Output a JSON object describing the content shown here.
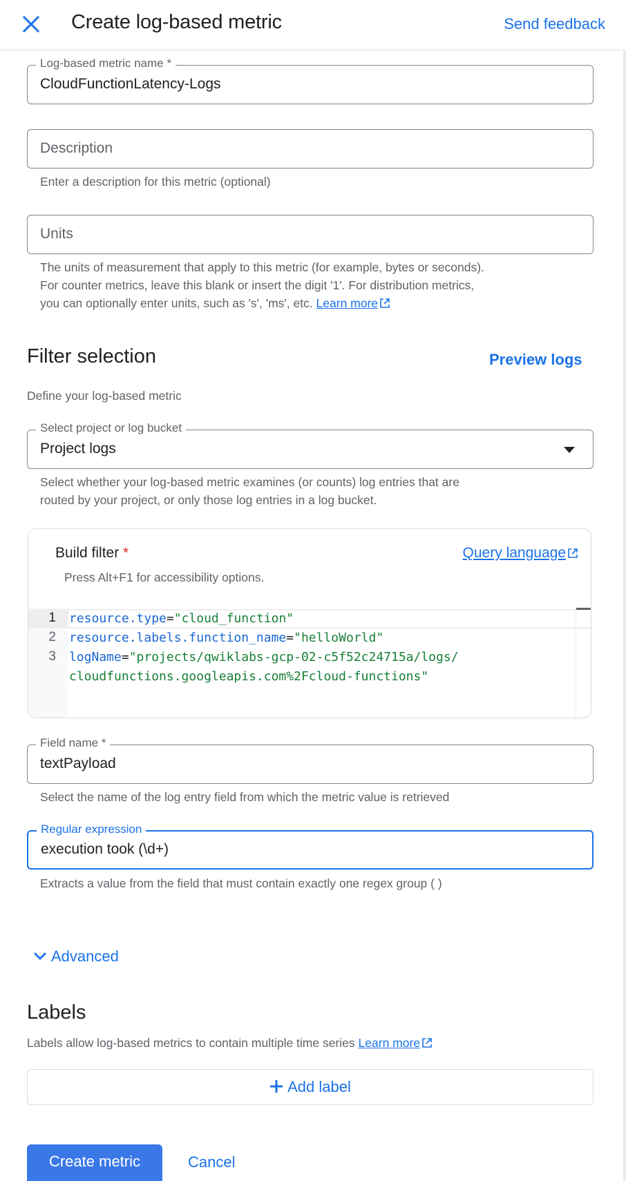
{
  "header": {
    "title": "Create log-based metric",
    "close_icon": "close-icon",
    "send_feedback": "Send feedback"
  },
  "fields": {
    "metric_name": {
      "label": "Log-based metric name *",
      "value": "CloudFunctionLatency-Logs"
    },
    "description": {
      "placeholder": "Description",
      "value": "",
      "helper": "Enter a description for this metric (optional)"
    },
    "units": {
      "placeholder": "Units",
      "value": "",
      "helper_lines": [
        "The units of measurement that apply to this metric (for example, bytes or seconds).",
        "For counter metrics, leave this blank or insert the digit '1'. For distribution metrics,",
        "you can optionally enter units, such as 's', 'ms', etc."
      ],
      "learn_more": "Learn more"
    }
  },
  "filter_selection": {
    "title": "Filter selection",
    "preview_logs": "Preview logs",
    "subtitle": "Define your log-based metric",
    "bucket_select": {
      "label": "Select project or log bucket",
      "selected": "Project logs",
      "helper_lines": [
        "Select whether your log-based metric examines (or counts) log entries that are",
        "routed by your project, or only those log entries in a log bucket."
      ]
    },
    "build_filter": {
      "label": "Build filter",
      "required_mark": "*",
      "query_language": "Query language",
      "accessibility_hint": "Press Alt+F1 for accessibility options.",
      "lines": [
        {
          "number": "1",
          "key": "resource.type",
          "op": "=",
          "value": "\"cloud_function\""
        },
        {
          "number": "2",
          "key": "resource.labels.function_name",
          "op": "=",
          "value": "\"helloWorld\""
        },
        {
          "number": "3",
          "key": "logName",
          "op": "=",
          "value": "\"projects/qwiklabs-gcp-02-c5f52c24715a/logs/"
        },
        {
          "number": "",
          "key": "",
          "op": "",
          "value": "cloudfunctions.googleapis.com%2Fcloud-functions\""
        }
      ]
    },
    "field_name": {
      "label": "Field name *",
      "value": "textPayload",
      "helper": "Select the name of the log entry field from which the metric value is retrieved"
    },
    "regex": {
      "label": "Regular expression",
      "value": "execution took (\\d+)",
      "helper": "Extracts a value from the field that must contain exactly one regex group ( )"
    },
    "advanced": "Advanced"
  },
  "labels_section": {
    "title": "Labels",
    "subtitle": "Labels allow log-based metrics to contain multiple time series",
    "learn_more": "Learn more",
    "add_label": "Add label"
  },
  "actions": {
    "create": "Create metric",
    "cancel": "Cancel"
  },
  "colors": {
    "accent": "#1a73e8",
    "primary_button": "#3b78e7",
    "required": "#d93025",
    "code_key": "#1967d2",
    "code_string": "#188038"
  }
}
